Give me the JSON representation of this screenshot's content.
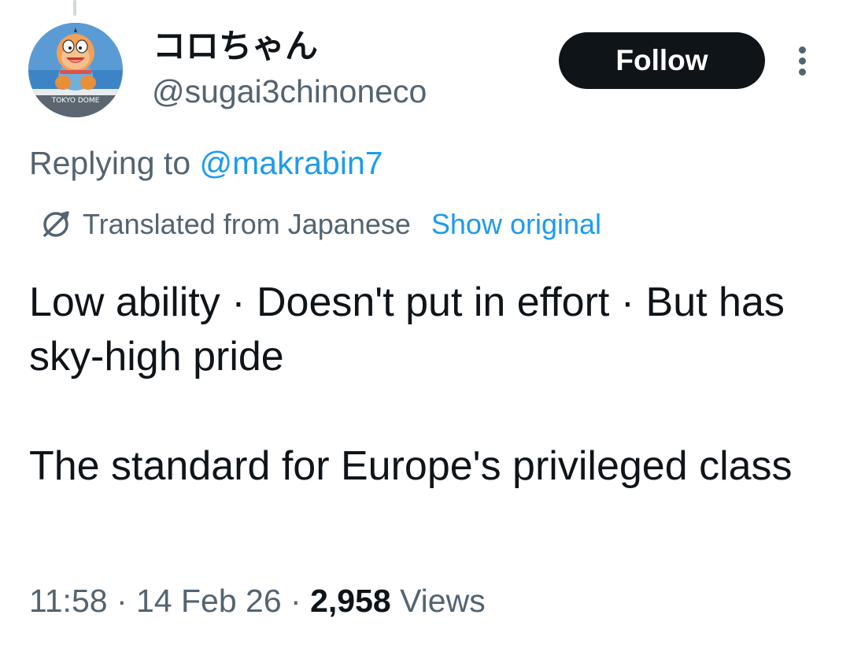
{
  "author": {
    "display_name": "コロちゃん",
    "handle": "@sugai3chinoneco",
    "avatar_icon": "cartoon-character-avatar-icon",
    "avatar_sign_text": "TOKYO DOME"
  },
  "follow_button": {
    "label": "Follow"
  },
  "more_menu": {
    "icon": "vertical-ellipsis-icon"
  },
  "reply": {
    "prefix": "Replying to ",
    "mention": "@makrabin7"
  },
  "translation": {
    "icon": "globe-icon",
    "label": "Translated from Japanese",
    "show_original": "Show original"
  },
  "tweet": {
    "paragraphs": [
      "Low ability · Doesn't put in effort · But has sky-high pride",
      "The standard for Europe's privileged class"
    ]
  },
  "meta": {
    "time": "11:58",
    "sep1": " · ",
    "date": "14 Feb 26",
    "sep2": " · ",
    "views_count": "2,958",
    "views_label": " Views"
  },
  "colors": {
    "text_primary": "#0f1419",
    "text_secondary": "#536471",
    "link": "#1d9bf0",
    "button_bg": "#0f1419"
  }
}
